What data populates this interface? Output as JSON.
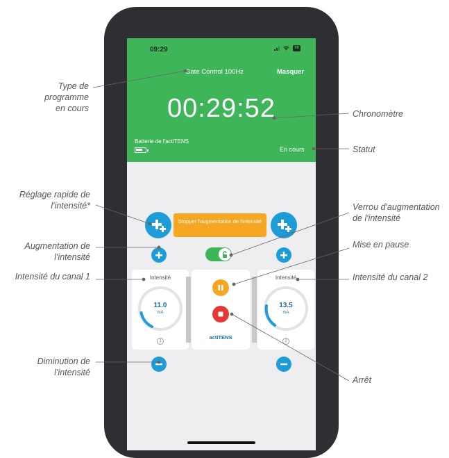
{
  "status_bar": {
    "time": "09:29",
    "battery": "90"
  },
  "header": {
    "program": "Gate Control 100Hz",
    "hide_label": "Masquer",
    "timer": "00:29:52",
    "battery_label": "Batterie de l'actiTENS",
    "status": "En cours"
  },
  "controls": {
    "stop_increase_label": "Stopper l'augmentation de l'intensité",
    "channel1": {
      "label": "Intensité",
      "value": "11.0",
      "unit": "mA",
      "number": "1"
    },
    "channel2": {
      "label": "Intensité",
      "value": "13.5",
      "unit": "mA",
      "number": "2"
    },
    "brand": "actiTENS"
  },
  "annotations": {
    "program_type": "Type de programme en cours",
    "chronometer": "Chronomètre",
    "status": "Statut",
    "quick_adjust": "Réglage rapide de l'intensité*",
    "lock": "Verrou d'augmentation de l'intensité",
    "increase": "Augmentation de l'intensité",
    "pause": "Mise en pause",
    "channel1": "Intensité du canal 1",
    "channel2": "Intensité du canal 2",
    "decrease": "Diminution de l'intensité",
    "stop": "Arrêt"
  },
  "colors": {
    "header_green": "#3fb55a",
    "button_blue": "#1d9cd8",
    "orange": "#f5a623",
    "stop_red": "#e53935"
  }
}
